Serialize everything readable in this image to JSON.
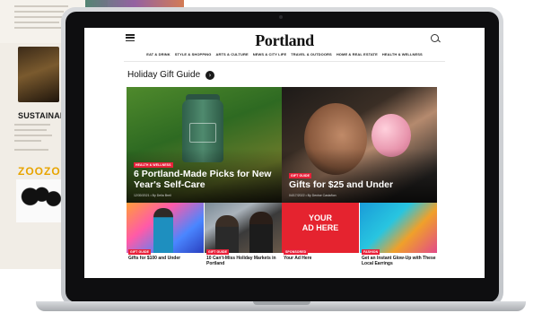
{
  "site": {
    "logo": "Portland",
    "nav": [
      "EAT & DRINK",
      "STYLE & SHOPPING",
      "ARTS & CULTURE",
      "NEWS & CITY LIFE",
      "TRAVEL & OUTDOORS",
      "HOME & REAL ESTATE",
      "HEALTH & WELLNESS"
    ]
  },
  "section": {
    "title": "Holiday Gift Guide"
  },
  "hero": [
    {
      "tag": "HEALTH & WELLNESS",
      "title": "6 Portland-Made Picks for New Year's Self-Care",
      "byline": "12/30/2021 • By Delia Breil"
    },
    {
      "tag": "GIFT GUIDE",
      "title": "Gifts for $25 and Under",
      "byline": "04/17/2022 • By Denise Castañon"
    }
  ],
  "cards": [
    {
      "tag": "GIFT GUIDE",
      "title": "Gifts for $100 and Under"
    },
    {
      "tag": "GIFT GUIDE",
      "title": "10 Can't-Miss Holiday Markets in Portland"
    },
    {
      "tag": "SPONSORED",
      "title": "Your Ad Here",
      "ad_text": "YOUR AD HERE"
    },
    {
      "tag": "FASHION",
      "title": "Get an Instant Glow-Up with These Local Earrings"
    }
  ],
  "magazine": {
    "headline": "SUSTAINABI",
    "brand": "ZOOZO"
  },
  "colors": {
    "accent": "#e8213a",
    "ad_background": "#e5232f"
  }
}
